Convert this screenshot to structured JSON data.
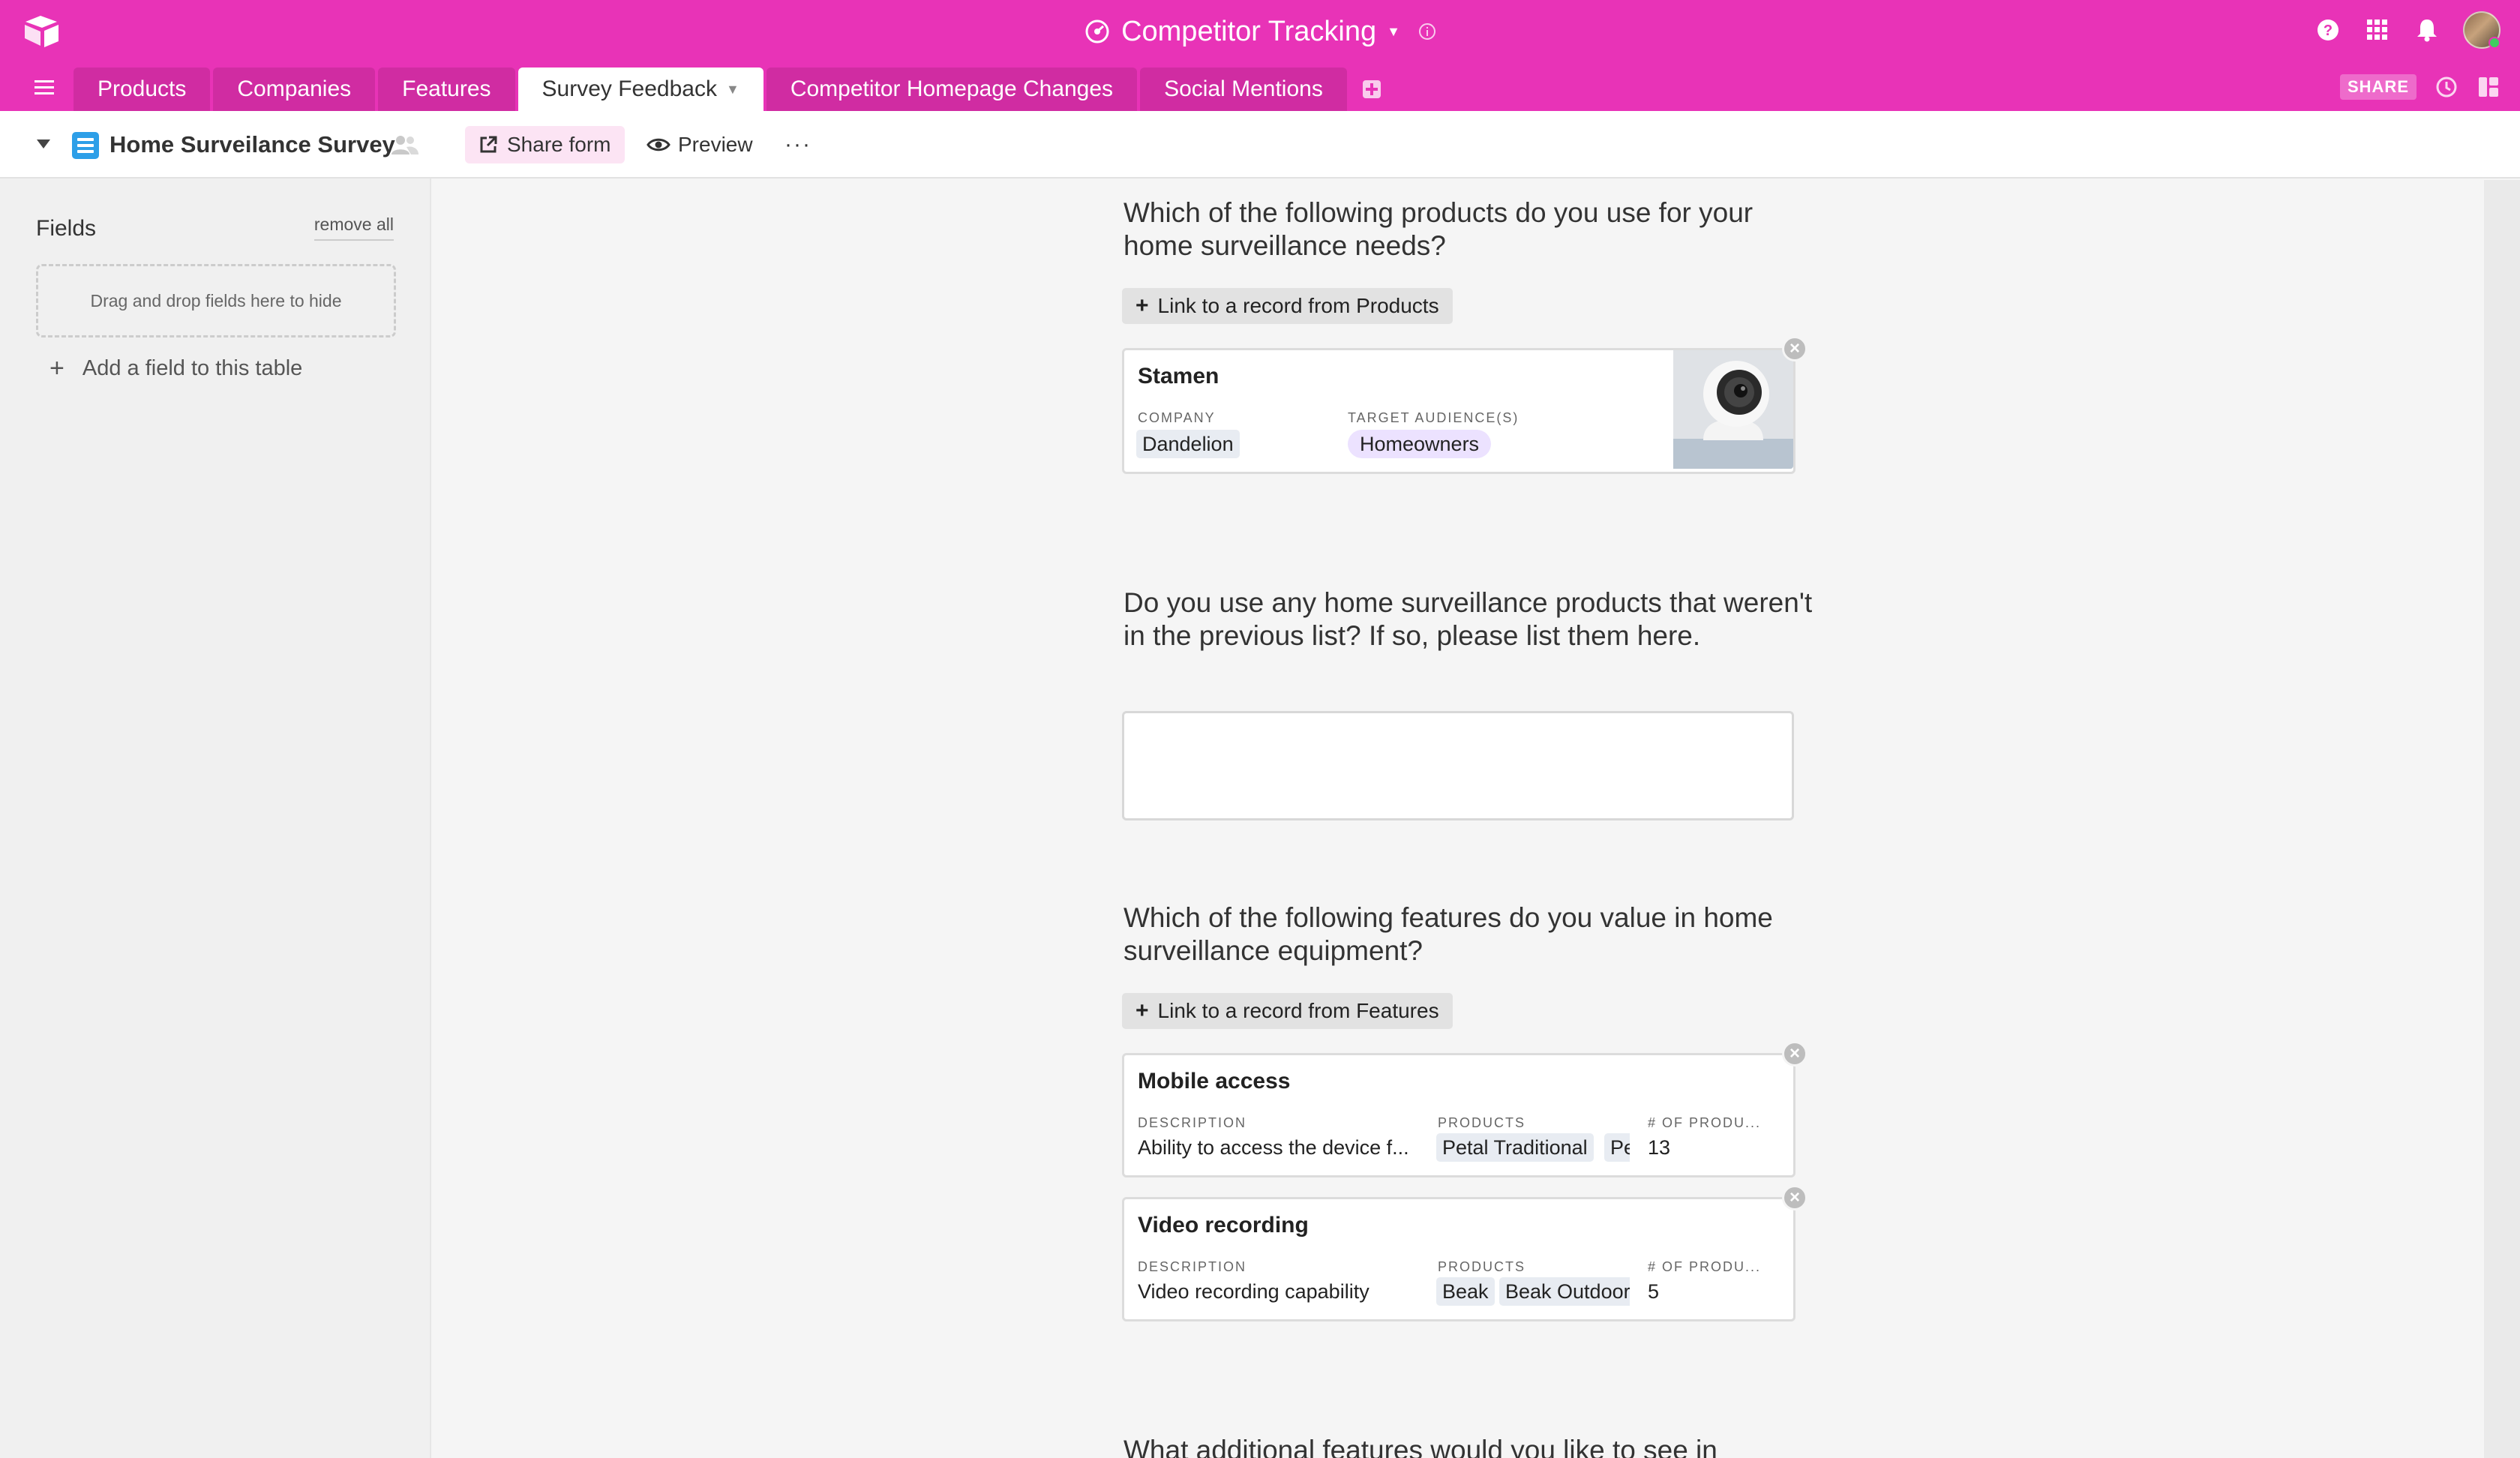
{
  "app": {
    "base_title": "Competitor Tracking"
  },
  "tabs": [
    {
      "label": "Products"
    },
    {
      "label": "Companies"
    },
    {
      "label": "Features"
    },
    {
      "label": "Survey Feedback"
    },
    {
      "label": "Competitor Homepage Changes"
    },
    {
      "label": "Social Mentions"
    }
  ],
  "toolbar": {
    "share_badge": "SHARE"
  },
  "view": {
    "name": "Home Surveilance Survey",
    "share_form_label": "Share form",
    "preview_label": "Preview",
    "more_label": "···"
  },
  "sidebar": {
    "heading": "Fields",
    "remove_all": "remove all",
    "dropzone": "Drag and drop fields here to hide",
    "add_field": "Add a field to this table"
  },
  "form": {
    "q1": {
      "question": "Which of the following products do you use for your home surveillance needs?",
      "link_label": "Link to a record from Products",
      "records": [
        {
          "title": "Stamen",
          "fields": [
            {
              "label": "COMPANY",
              "chips": [
                "Dandelion"
              ]
            },
            {
              "label": "TARGET AUDIENCE(S)",
              "chips": [
                "Homeowners"
              ]
            }
          ]
        }
      ]
    },
    "q2": {
      "question": "Do you use any home surveillance products that weren't in the previous list? If so, please list them here.",
      "value": ""
    },
    "q3": {
      "question": "Which of the following features do you value in home surveillance equipment?",
      "link_label": "Link to a record from Features",
      "records": [
        {
          "title": "Mobile access",
          "description_label": "DESCRIPTION",
          "description": "Ability to access the device f...",
          "products_label": "PRODUCTS",
          "products": [
            "Petal Traditional",
            "Pe"
          ],
          "count_label": "# OF PRODU...",
          "count": "13"
        },
        {
          "title": "Video recording",
          "description_label": "DESCRIPTION",
          "description": "Video recording capability",
          "products_label": "PRODUCTS",
          "products": [
            "Beak",
            "Beak Outdoor"
          ],
          "count_label": "# OF PRODU...",
          "count": "5"
        }
      ]
    },
    "q4": {
      "question": "What additional features would you like to see in"
    }
  },
  "icons": {
    "logo": "airtable-logo-icon",
    "base": "gauge-icon",
    "help": "help-icon",
    "apps": "apps-grid-icon",
    "notifications": "bell-icon",
    "history": "history-icon",
    "blocks": "blocks-icon"
  },
  "colors": {
    "brand": "#e833b7",
    "tab_inactive": "#d02ca2",
    "form_icon": "#2d9fe8",
    "share_form_bg": "#fce4f4",
    "chip_purple": "#ece2ff",
    "chip_gray": "#e8ecf2"
  }
}
